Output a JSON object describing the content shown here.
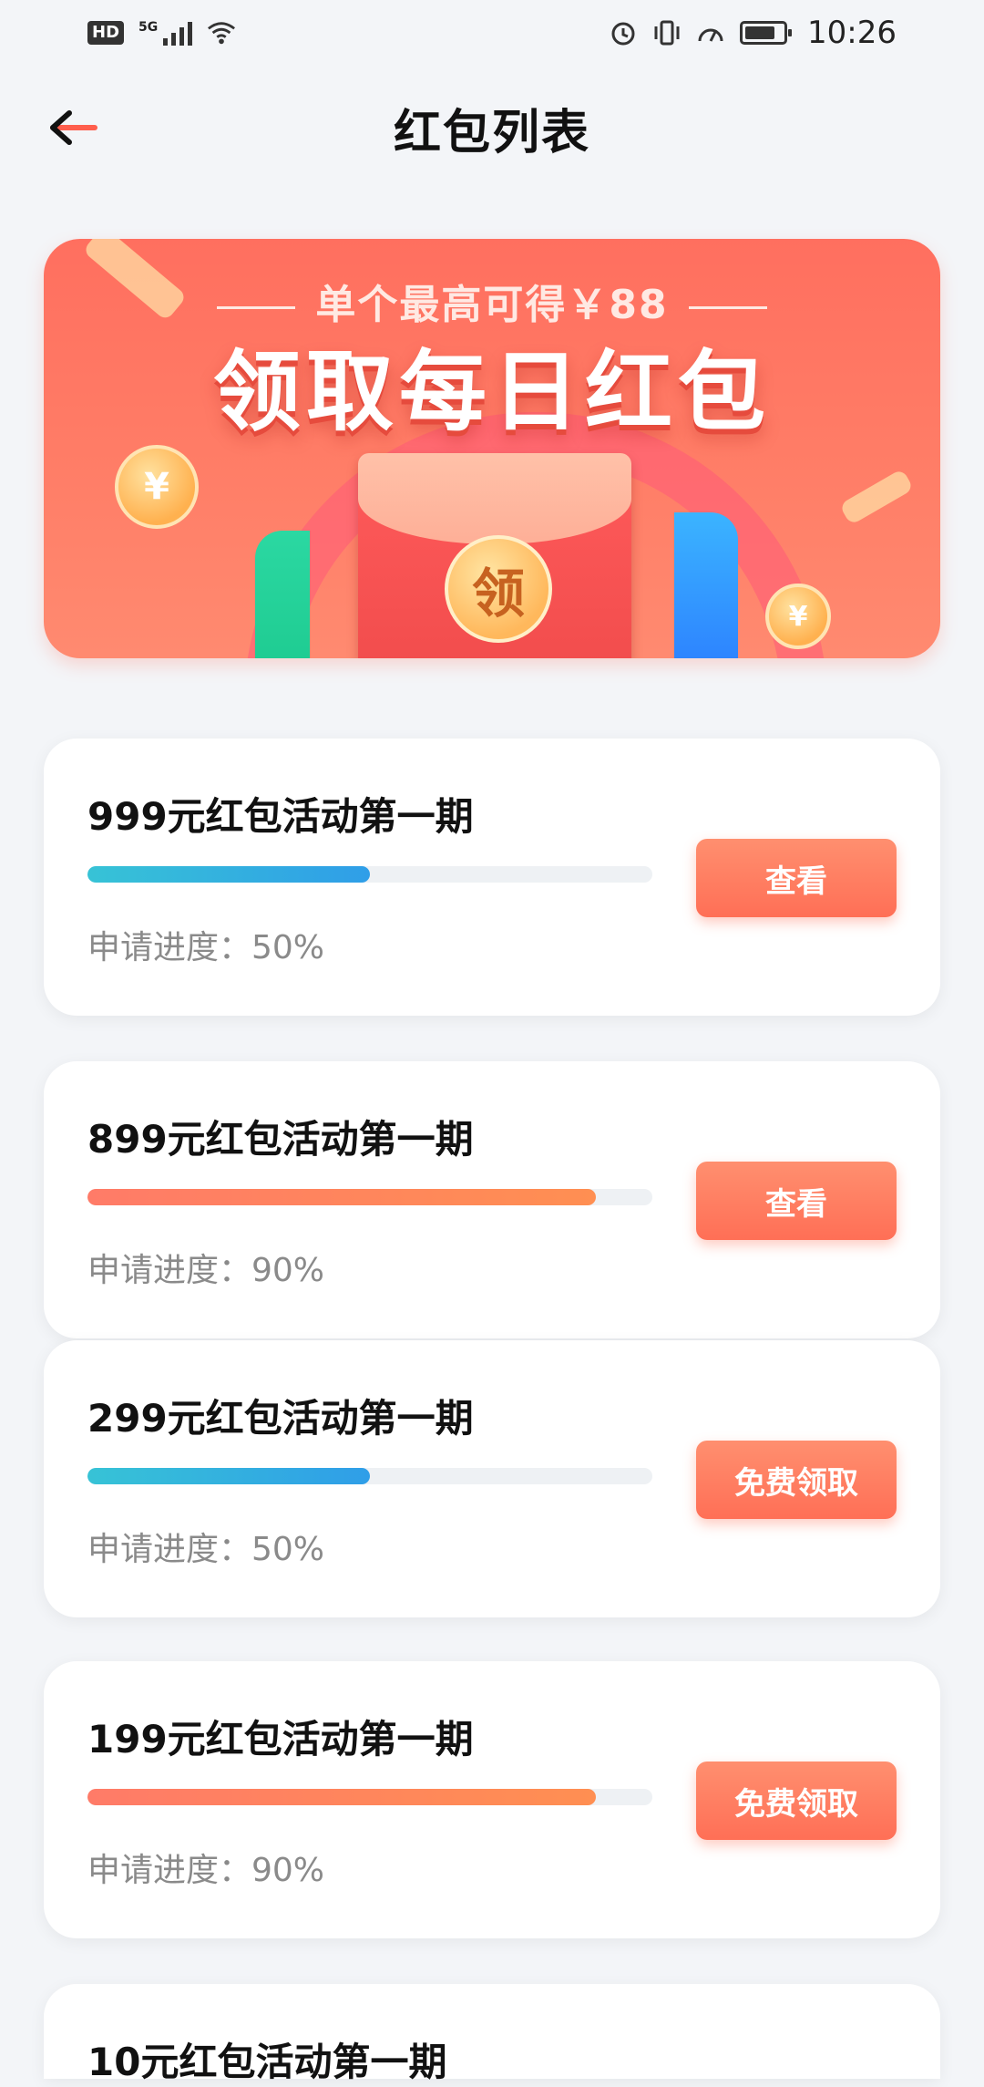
{
  "status_bar": {
    "network_badge": "HD",
    "network_type": "5G",
    "time": "10:26",
    "icons": [
      "signal-icon",
      "wifi-icon",
      "alarm-icon",
      "vibrate-icon",
      "speedometer-icon",
      "battery-icon"
    ]
  },
  "header": {
    "title": "红包列表",
    "back_icon": "back-arrow-icon"
  },
  "banner": {
    "subtitle": "单个最高可得￥88",
    "title": "领取每日红包",
    "envelope_text": "领",
    "coin_symbol": "¥",
    "colors": {
      "primary": "#ff6f5f",
      "accent": "#ffb14f"
    }
  },
  "list": {
    "items": [
      {
        "title": "999元红包活动第一期",
        "progress_label": "申请进度：50%",
        "progress": 0.5,
        "bar_color": "blue",
        "button": "查看"
      },
      {
        "title": "899元红包活动第一期",
        "progress_label": "申请进度：90%",
        "progress": 0.9,
        "bar_color": "orange",
        "button": "查看"
      },
      {
        "title": "299元红包活动第一期",
        "progress_label": "申请进度：50%",
        "progress": 0.5,
        "bar_color": "blue",
        "button": "免费领取"
      },
      {
        "title": "199元红包活动第一期",
        "progress_label": "申请进度：90%",
        "progress": 0.9,
        "bar_color": "orange",
        "button": "免费领取"
      },
      {
        "title": "10元红包活动第一期"
      }
    ]
  }
}
